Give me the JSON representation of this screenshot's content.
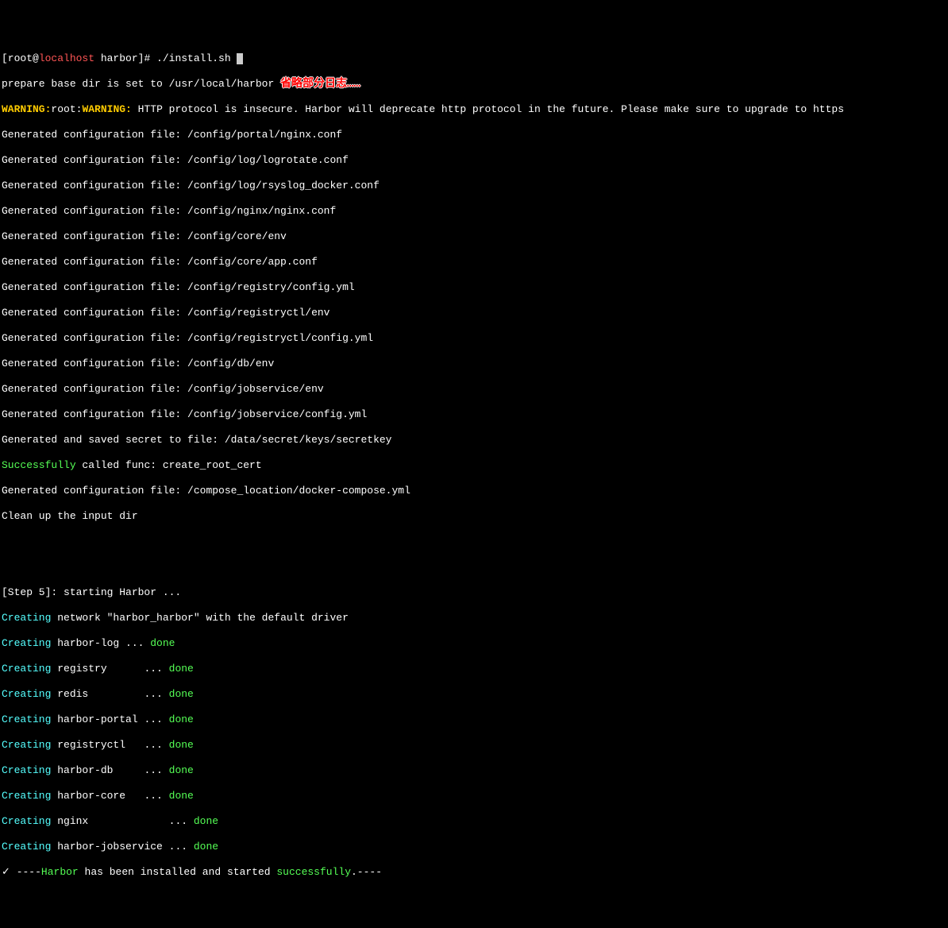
{
  "prompt": {
    "prefix": "[root@",
    "host": "localhost",
    "path": " harbor]# ",
    "command": "./install.sh "
  },
  "annotation": "省略部分日志……",
  "lines": {
    "prepare": "prepare base dir is set to /usr/local/harbor ",
    "warning_prefix1": "WARNING:",
    "warning_root": "root:",
    "warning_prefix2": "WARNING:",
    "warning_text": " HTTP protocol is insecure. Harbor will deprecate http protocol in the future. Please make sure to upgrade to https",
    "gen": [
      "Generated configuration file: /config/portal/nginx.conf",
      "Generated configuration file: /config/log/logrotate.conf",
      "Generated configuration file: /config/log/rsyslog_docker.conf",
      "Generated configuration file: /config/nginx/nginx.conf",
      "Generated configuration file: /config/core/env",
      "Generated configuration file: /config/core/app.conf",
      "Generated configuration file: /config/registry/config.yml",
      "Generated configuration file: /config/registryctl/env",
      "Generated configuration file: /config/registryctl/config.yml",
      "Generated configuration file: /config/db/env",
      "Generated configuration file: /config/jobservice/env",
      "Generated configuration file: /config/jobservice/config.yml",
      "Generated and saved secret to file: /data/secret/keys/secretkey"
    ],
    "success_prefix": "Successfully",
    "success_rest": " called func: create_root_cert",
    "gen_compose": "Generated configuration file: /compose_location/docker-compose.yml",
    "cleanup": "Clean up the input dir",
    "step5": "[Step 5]: starting Harbor ...",
    "creating_network": {
      "prefix": "Creating",
      "rest": " network \"harbor_harbor\" with the default driver"
    },
    "services": [
      {
        "name": " harbor-log ... ",
        "done": "done"
      },
      {
        "name": " registry      ... ",
        "done": "done"
      },
      {
        "name": " redis         ... ",
        "done": "done"
      },
      {
        "name": " harbor-portal ... ",
        "done": "done"
      },
      {
        "name": " registryctl   ... ",
        "done": "done"
      },
      {
        "name": " harbor-db     ... ",
        "done": "done"
      },
      {
        "name": " harbor-core   ... ",
        "done": "done"
      },
      {
        "name": " nginx             ... ",
        "done": "done"
      },
      {
        "name": " harbor-jobservice ... ",
        "done": "done"
      }
    ],
    "final": {
      "check": "✓ ",
      "dash1": "----",
      "harbor": "Harbor",
      "mid": " has been installed and started ",
      "success": "successfully",
      "dash2": ".----"
    }
  }
}
